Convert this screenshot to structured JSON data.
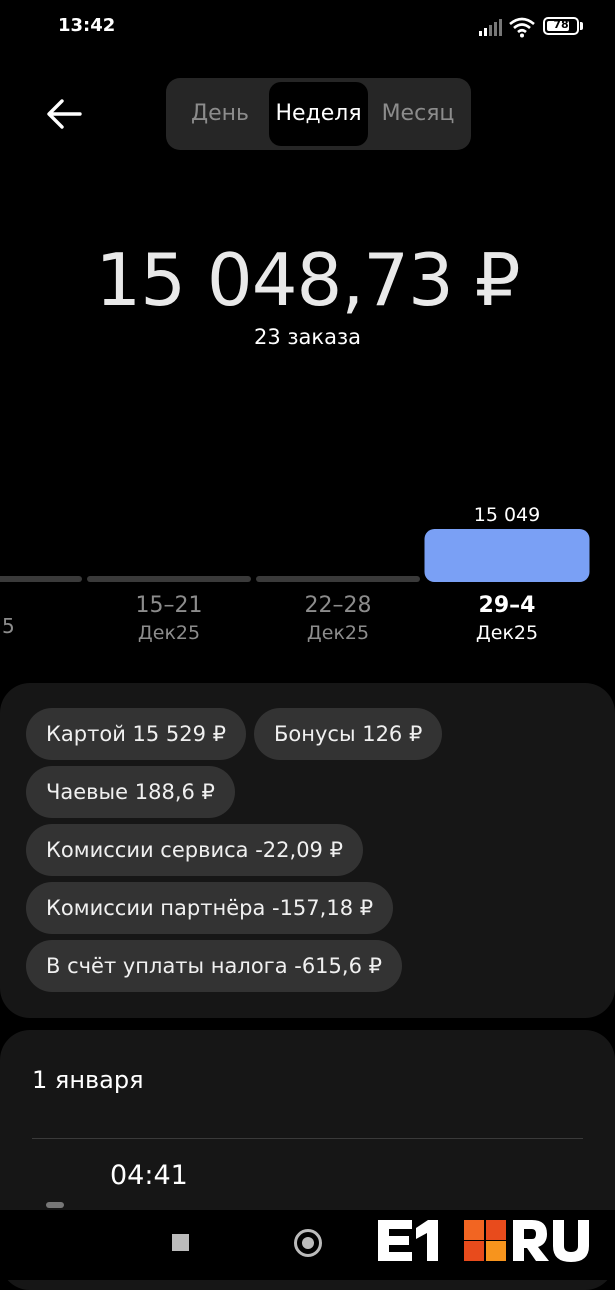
{
  "status_bar": {
    "time": "13:42",
    "battery": "78",
    "battery_level": 0.78
  },
  "header": {
    "back_icon": "arrow-left-icon",
    "tabs": [
      {
        "label": "День",
        "active": false
      },
      {
        "label": "Неделя",
        "active": true
      },
      {
        "label": "Месяц",
        "active": false
      }
    ]
  },
  "summary": {
    "total": "15 048,73 ₽",
    "orders": "23 заказа"
  },
  "chart_data": {
    "type": "bar",
    "categories": [
      "15–21",
      "22–28",
      "29–4"
    ],
    "category_sub": [
      "Дек25",
      "Дек25",
      "Дек25"
    ],
    "values": [
      0,
      0,
      15049
    ],
    "top_label": "15 049",
    "selected_index": 2,
    "colors": {
      "selected": "#7aa0f5",
      "empty": "#3a3a3a"
    }
  },
  "breakdown": {
    "items": [
      {
        "label": "Картой 15 529 ₽"
      },
      {
        "label": "Бонусы 126 ₽"
      },
      {
        "label": "Чаевые 188,6 ₽"
      },
      {
        "label": "Комиссии сервиса -22,09 ₽"
      },
      {
        "label": "Комиссии партнёра -157,18 ₽"
      },
      {
        "label": "В счёт уплаты налога -615,6 ₽"
      }
    ]
  },
  "history": {
    "date": "1 января",
    "entries": [
      {
        "time": "04:41"
      }
    ]
  },
  "nav": {
    "icons": [
      "recent-apps-icon",
      "home-icon"
    ]
  },
  "watermark": {
    "text": "E1RU"
  }
}
